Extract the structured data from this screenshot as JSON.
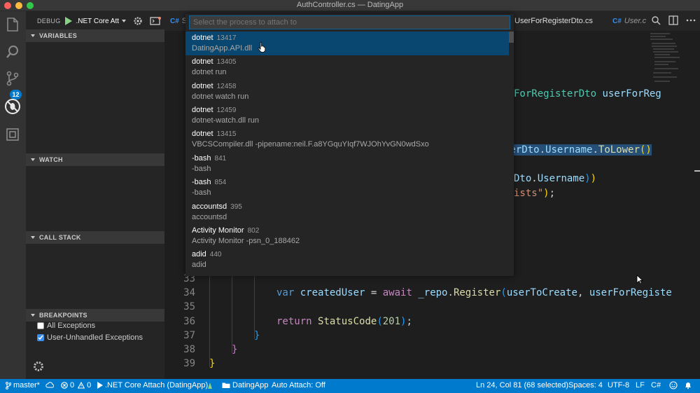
{
  "window": {
    "title": "AuthController.cs — DatingApp"
  },
  "activity_bar": {
    "scm_badge": "12"
  },
  "debug": {
    "label": "DEBUG",
    "configuration": ".NET Core Att"
  },
  "sections": {
    "variables": "VARIABLES",
    "watch": "WATCH",
    "call_stack": "CALL STACK",
    "breakpoints": "BREAKPOINTS"
  },
  "breakpoints": [
    {
      "label": "All Exceptions",
      "checked": false
    },
    {
      "label": "User-Unhandled Exceptions",
      "checked": true
    }
  ],
  "tabs": [
    {
      "label": "S",
      "icon": "C#"
    },
    {
      "label": "UserForRegisterDto.cs",
      "icon": ""
    },
    {
      "label": "User.c",
      "icon": "C#"
    }
  ],
  "quick_pick": {
    "placeholder": "Select the process to attach to",
    "items": [
      {
        "name": "dotnet",
        "pid": "13417",
        "detail": "DatingApp.API.dll",
        "selected": true
      },
      {
        "name": "dotnet",
        "pid": "13405",
        "detail": "dotnet run"
      },
      {
        "name": "dotnet",
        "pid": "12458",
        "detail": "dotnet watch run"
      },
      {
        "name": "dotnet",
        "pid": "12459",
        "detail": "dotnet-watch.dll run"
      },
      {
        "name": "dotnet",
        "pid": "13415",
        "detail": "VBCSCompiler.dll -pipename:neil.F.a8YGquYIqf7WJOhYvGN0wdSxo"
      },
      {
        "name": "-bash",
        "pid": "841",
        "detail": "-bash"
      },
      {
        "name": "-bash",
        "pid": "854",
        "detail": "-bash"
      },
      {
        "name": "accountsd",
        "pid": "395",
        "detail": "accountsd"
      },
      {
        "name": "Activity Monitor",
        "pid": "802",
        "detail": "Activity Monitor -psn_0_188462"
      },
      {
        "name": "adid",
        "pid": "440",
        "detail": "adid"
      }
    ]
  },
  "code": {
    "line_numbers": [
      "33",
      "34",
      "35",
      "36",
      "37",
      "38",
      "39"
    ],
    "peek_fragments": {
      "line_a": "ForRegisterDto userForReg",
      "line_b": "terDto.Username.ToLower()",
      "line_c": "Dto.Username))",
      "line_d": "ists\");"
    }
  },
  "status_bar": {
    "branch": "master*",
    "errors": "0",
    "warnings": "0",
    "debug_config": ".NET Core Attach (DatingApp)",
    "folder": "DatingApp",
    "auto_attach": "Auto Attach: Off",
    "position": "Ln 24, Col 81 (68 selected)",
    "spaces": "Spaces: 4",
    "encoding": "UTF-8",
    "eol": "LF",
    "language": "C#"
  },
  "colors": {
    "accent": "#007acc",
    "selection": "#094771",
    "badge": "#007acc"
  }
}
